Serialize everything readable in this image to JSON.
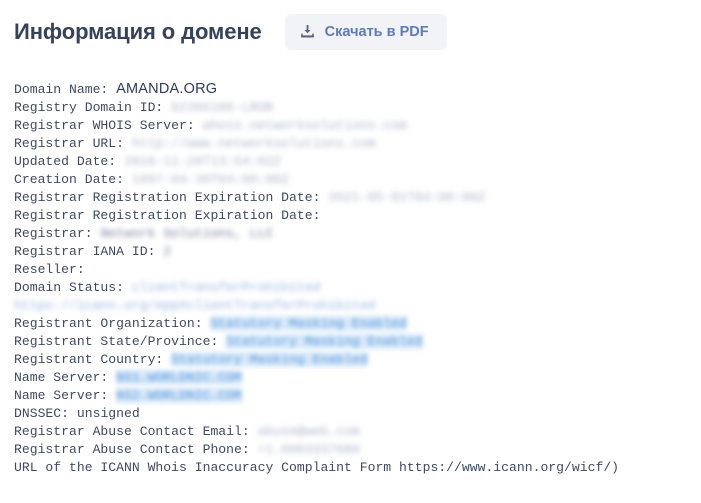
{
  "header": {
    "title": "Информация о домене",
    "download_button": {
      "label": "Скачать в PDF",
      "icon": "download-icon"
    }
  },
  "colors": {
    "title": "#36415a",
    "button_bg": "#f1f3f7",
    "button_text": "#5f7ab8",
    "body_text": "#3f4a62",
    "highlight_bg": "#d6e8fa",
    "highlight_text": "#4c8fd8",
    "page_bg": "#ffffff"
  },
  "whois": {
    "lines": [
      {
        "label": "Domain Name: ",
        "value": "AMANDA.ORG",
        "style": "domain"
      },
      {
        "label": "Registry Domain ID: ",
        "value": "D2365166-LROR",
        "style": "masked"
      },
      {
        "label": "Registrar WHOIS Server: ",
        "value": "whois.networksolutions.com",
        "style": "masked"
      },
      {
        "label": "Registrar URL: ",
        "value": "http://www.networksolutions.com",
        "style": "masked"
      },
      {
        "label": "Updated Date: ",
        "value": "2018-11-20T13:54:02Z",
        "style": "masked"
      },
      {
        "label": "Creation Date: ",
        "value": "1997-04-30T04:00:00Z",
        "style": "masked"
      },
      {
        "label": "Registrar Registration Expiration Date: ",
        "value": "2021-05-01T04:00:00Z",
        "style": "masked"
      },
      {
        "label": "Registrar Registration Expiration Date:",
        "value": "",
        "style": "plain"
      },
      {
        "label": "Registrar: ",
        "value": "Network Solutions, LLC",
        "style": "masked-dark"
      },
      {
        "label": "Registrar IANA ID: ",
        "value": "2",
        "style": "masked-dark"
      },
      {
        "label": "Reseller:",
        "value": "",
        "style": "plain"
      },
      {
        "label": "Domain Status: ",
        "value": "clientTransferProhibited https://icann.org/epp#clientTransferProhibited",
        "style": "masked-blue"
      },
      {
        "label": "Registrant Organization: ",
        "value": "Statutory Masking Enabled",
        "style": "highlight"
      },
      {
        "label": "Registrant State/Province: ",
        "value": "Statutory Masking Enabled",
        "style": "highlight"
      },
      {
        "label": "Registrant Country: ",
        "value": "Statutory Masking Enabled",
        "style": "highlight"
      },
      {
        "label": "Name Server: ",
        "value": "NS1.WORLDNIC.COM",
        "style": "highlight"
      },
      {
        "label": "Name Server: ",
        "value": "NS2.WORLDNIC.COM",
        "style": "highlight"
      },
      {
        "label": "DNSSEC: ",
        "value": "unsigned",
        "style": "plain"
      },
      {
        "label": "Registrar Abuse Contact Email: ",
        "value": "abuse@web.com",
        "style": "masked"
      },
      {
        "label": "Registrar Abuse Contact Phone: ",
        "value": "+1.8003337680",
        "style": "masked"
      },
      {
        "label": "URL of the ICANN Whois Inaccuracy Complaint Form https://www.icann.org/wicf/)",
        "value": "",
        "style": "plain"
      }
    ]
  }
}
